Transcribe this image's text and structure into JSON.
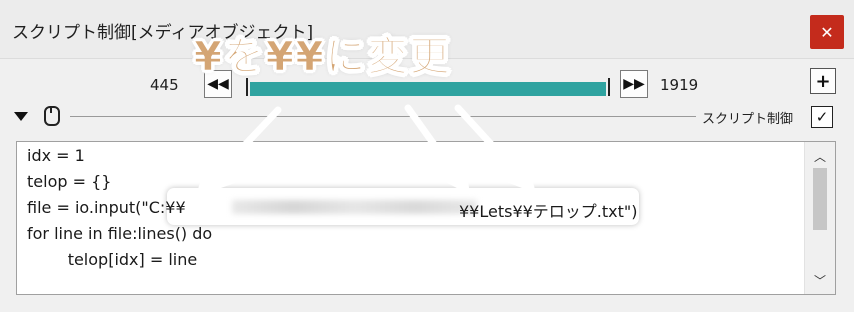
{
  "window": {
    "title": "スクリプト制御[メディアオブジェクト]",
    "close_icon": "close-icon"
  },
  "timeline": {
    "start_frame": "445",
    "end_frame": "1919",
    "prev_icon": "rewind-icon",
    "next_icon": "fast-forward-icon",
    "add_label": "+",
    "fill_color": "#2fa3a0"
  },
  "section": {
    "label": "スクリプト制御",
    "checked_glyph": "✓"
  },
  "editor": {
    "lines": [
      "idx = 1",
      "telop = {}",
      "file = io.input(\"C:¥¥",
      "for line in file:lines() do",
      "        telop[idx] = line"
    ],
    "line3_tail": "¥¥Lets¥¥テロップ.txt\")"
  },
  "annotation": {
    "text": "¥を¥¥に変更",
    "color": "#d4a574"
  }
}
